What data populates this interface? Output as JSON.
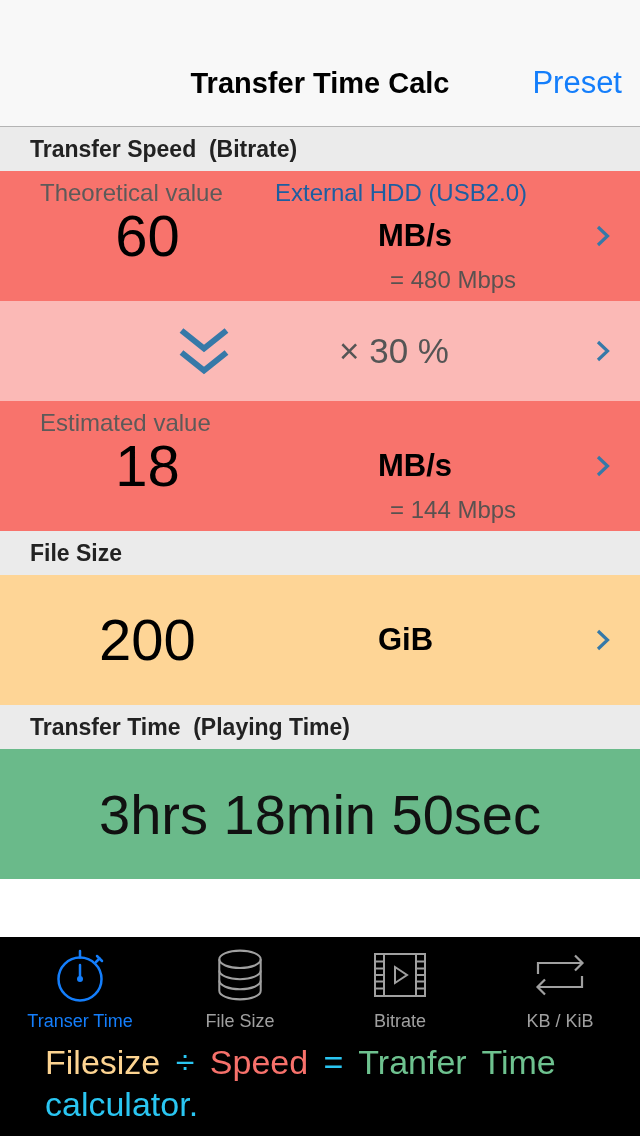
{
  "nav_bar": {
    "title": "Transfer Time Calc",
    "right_button": "Preset"
  },
  "sections": [
    {
      "header": "Transfer Speed  (Bitrate)",
      "rows": [
        {
          "kind": "value",
          "color": "#f8736c",
          "label": "Theoretical value",
          "preset": "External HDD (USB2.0)",
          "value": "60",
          "unit": "MB/s",
          "conversion": "= 480 Mbps",
          "disclosure": true
        },
        {
          "kind": "multiplier",
          "color": "#fbb9b6",
          "factor": "× 30 %",
          "disclosure": true
        },
        {
          "kind": "value",
          "color": "#f8736c",
          "label": "Estimated value",
          "value": "18",
          "unit": "MB/s",
          "conversion": "= 144 Mbps",
          "disclosure": true
        }
      ]
    },
    {
      "header": "File Size",
      "rows": [
        {
          "kind": "value",
          "color": "#fed596",
          "value": "200",
          "unit": "GiB",
          "disclosure": true
        }
      ]
    },
    {
      "header": "Transfer Time  (Playing Time)",
      "rows": [
        {
          "kind": "result",
          "color": "#6aba8a",
          "value": "3hrs 18min 50sec",
          "disclosure": false
        }
      ]
    }
  ],
  "tab_bar": [
    {
      "label": "Transer Time",
      "selected": true
    },
    {
      "label": "File Size",
      "selected": false
    },
    {
      "label": "Bitrate",
      "selected": false
    },
    {
      "label": "KB / KiB",
      "selected": false
    }
  ],
  "formula": [
    {
      "text": "Filesize",
      "color": "#fdd491"
    },
    {
      "text": "÷",
      "color": "#2ac6f2"
    },
    {
      "text": "Speed",
      "color": "#f7716b"
    },
    {
      "text": "=",
      "color": "#2ac6f2"
    },
    {
      "text": "Tranfer Time",
      "color": "#6ec28f"
    },
    {
      "text": "calculator.",
      "color": "#2ac6f2"
    }
  ]
}
